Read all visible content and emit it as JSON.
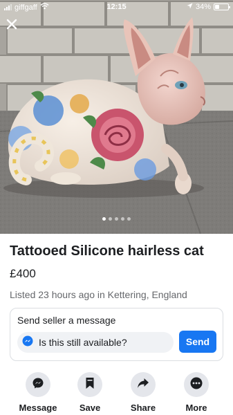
{
  "status_bar": {
    "carrier": "giffgaff",
    "time": "12:15",
    "battery": "34%",
    "battery_level": 0.34
  },
  "photo": {
    "current_index": 1,
    "total": 5
  },
  "listing": {
    "title": "Tattooed Silicone hairless cat",
    "price": "£400",
    "listed_info": "Listed 23 hours ago in Kettering, England"
  },
  "message_card": {
    "title": "Send seller a message",
    "input_value": "Is this still available?",
    "send_label": "Send"
  },
  "actions": [
    {
      "label": "Message",
      "icon": "messenger-icon"
    },
    {
      "label": "Save",
      "icon": "bookmark-icon"
    },
    {
      "label": "Share",
      "icon": "share-arrow-icon"
    },
    {
      "label": "More",
      "icon": "more-dots-icon"
    }
  ],
  "colors": {
    "accent": "#1877f2",
    "secondary_text": "#65676b",
    "button_bg": "#e4e6eb"
  }
}
